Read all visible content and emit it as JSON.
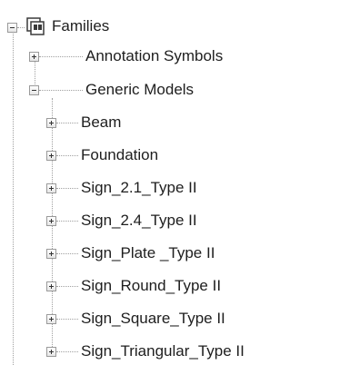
{
  "tree": {
    "root": {
      "label": "Families",
      "icon": "families-icon",
      "expanded": true
    },
    "categories": [
      {
        "label": "Annotation Symbols",
        "expanded": false
      },
      {
        "label": "Generic Models",
        "expanded": true,
        "children": [
          {
            "label": "Beam"
          },
          {
            "label": "Foundation"
          },
          {
            "label": "Sign_2.1_Type II"
          },
          {
            "label": "Sign_2.4_Type II"
          },
          {
            "label": "Sign_Plate _Type II"
          },
          {
            "label": "Sign_Round_Type II"
          },
          {
            "label": "Sign_Square_Type II"
          },
          {
            "label": "Sign_Triangular_Type II"
          }
        ]
      }
    ]
  }
}
